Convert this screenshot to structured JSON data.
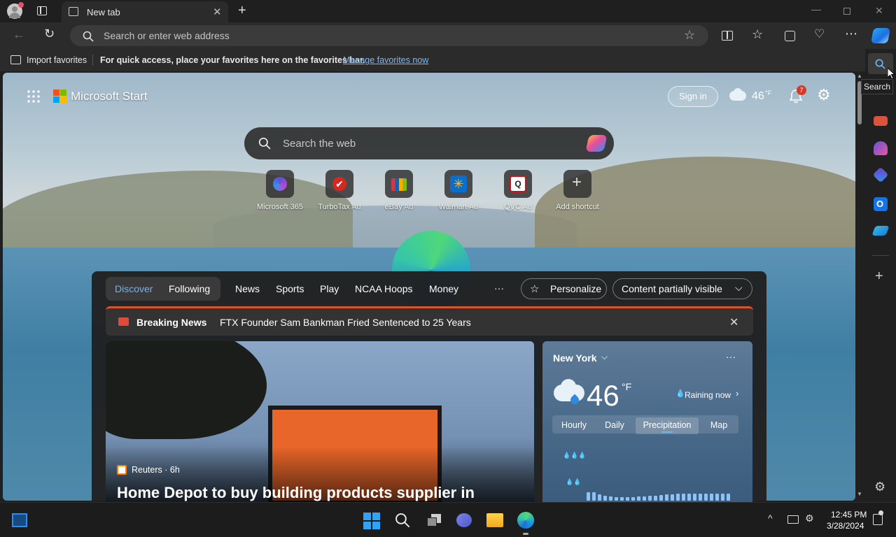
{
  "browser": {
    "tab_title": "New tab",
    "address_placeholder": "Search or enter web address",
    "favbar": {
      "import_label": "Import favorites",
      "message": "For quick access, place your favorites here on the favorites bar.",
      "manage_link": "Manage favorites now"
    },
    "tooltip": "Search"
  },
  "start": {
    "brand": "Microsoft Start",
    "sign_in": "Sign in",
    "weather_temp": "46",
    "weather_unit": "°F",
    "notif_count": "7",
    "search_placeholder": "Search the web",
    "shortcuts": [
      {
        "label": "Microsoft 365",
        "ad": ""
      },
      {
        "label": "TurboTax",
        "ad": "Ad"
      },
      {
        "label": "eBay",
        "ad": "Ad"
      },
      {
        "label": "Walmart",
        "ad": "Ad"
      },
      {
        "label": "QVC",
        "ad": "Ad"
      },
      {
        "label": "Add shortcut",
        "ad": ""
      }
    ]
  },
  "feed": {
    "tabs": [
      "Discover",
      "Following"
    ],
    "nav": [
      "News",
      "Sports",
      "Play",
      "NCAA Hoops",
      "Money"
    ],
    "more": "···",
    "personalize": "Personalize",
    "visibility": "Content partially visible",
    "breaking_label": "Breaking News",
    "breaking_text": "FTX Founder Sam Bankman Fried Sentenced to 25 Years",
    "article_source": "Reuters · 6h",
    "article_title": "Home Depot to buy building products supplier in"
  },
  "weather_card": {
    "city": "New York",
    "temp": "46",
    "unit": "°F",
    "status": "Raining now",
    "tabs": [
      "Hourly",
      "Daily",
      "Precipitation",
      "Map"
    ],
    "active_tab": "Precipitation"
  },
  "taskbar": {
    "time": "12:45 PM",
    "date": "3/28/2024"
  }
}
